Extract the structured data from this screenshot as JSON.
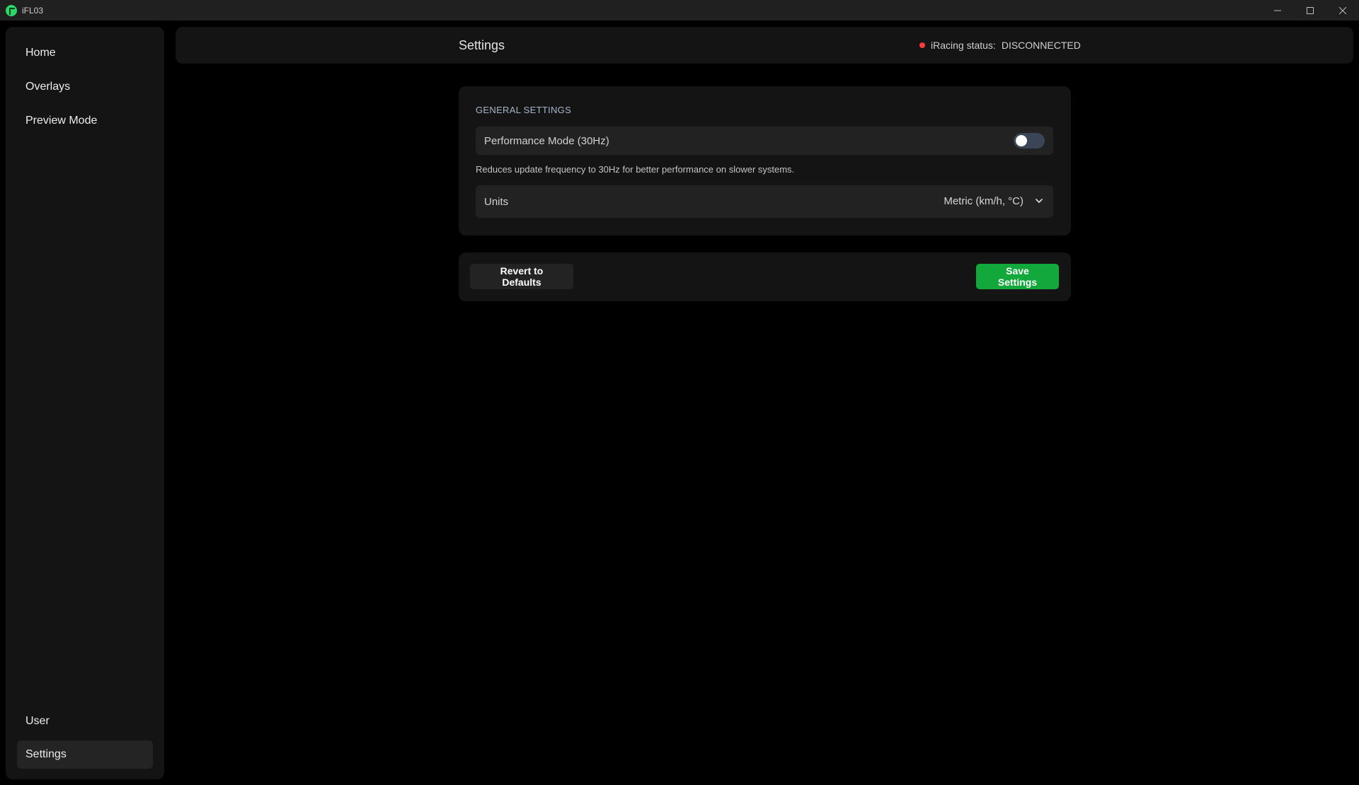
{
  "window": {
    "title": "iFL03",
    "controls": {
      "minimize": "minimize",
      "maximize": "maximize",
      "close": "close"
    }
  },
  "sidebar": {
    "top_items": [
      {
        "label": "Home"
      },
      {
        "label": "Overlays"
      },
      {
        "label": "Preview Mode"
      }
    ],
    "bottom_items": [
      {
        "label": "User"
      },
      {
        "label": "Settings",
        "active": true
      }
    ]
  },
  "header": {
    "title": "Settings",
    "status_label": "iRacing status:",
    "status_value": "DISCONNECTED",
    "status_color": "#ff3b3b"
  },
  "general_settings": {
    "heading": "GENERAL SETTINGS",
    "performance_mode": {
      "label": "Performance Mode (30Hz)",
      "enabled": false,
      "help": "Reduces update frequency to 30Hz for better performance on slower systems."
    },
    "units": {
      "label": "Units",
      "value": "Metric (km/h, °C)"
    }
  },
  "actions": {
    "revert_label": "Revert to Defaults",
    "save_label": "Save Settings",
    "save_color": "#12a83c"
  }
}
